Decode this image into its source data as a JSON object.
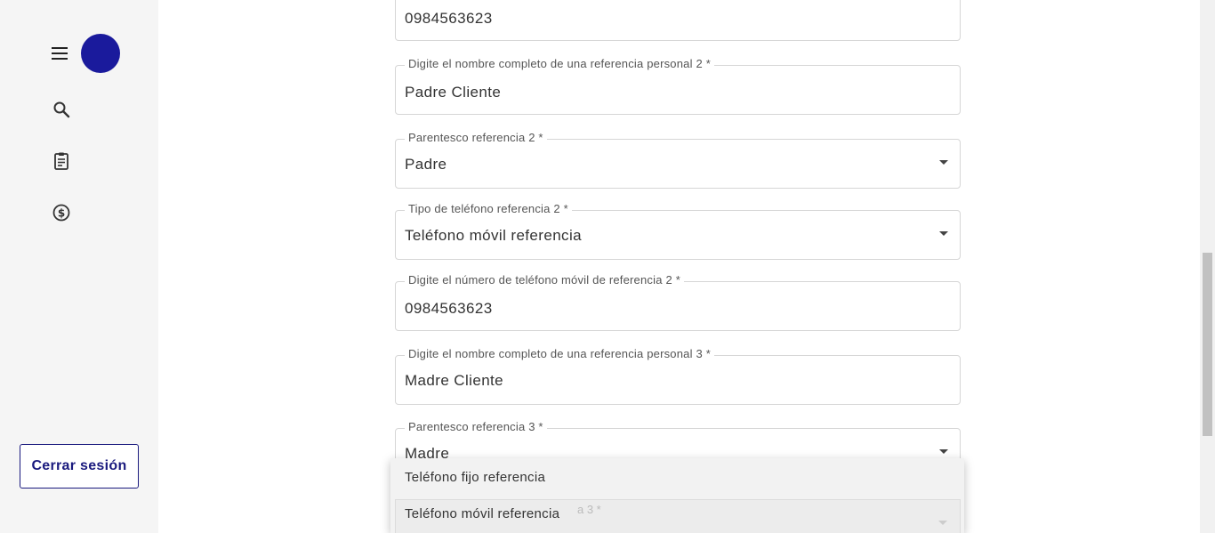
{
  "sidebar": {
    "logout_label": "Cerrar sesión",
    "icons": [
      "menu-icon",
      "search-icon",
      "clipboard-icon",
      "dollar-icon"
    ],
    "avatar_color": "#1a1a9c"
  },
  "form": {
    "fields": [
      {
        "label": "",
        "value": "0984563623",
        "type": "input"
      },
      {
        "label": "Digite el nombre completo de una referencia personal 2 *",
        "value": "Padre Cliente",
        "type": "input"
      },
      {
        "label": "Parentesco referencia 2 *",
        "value": "Padre",
        "type": "select"
      },
      {
        "label": "Tipo de teléfono referencia 2 *",
        "value": "Teléfono móvil referencia",
        "type": "select"
      },
      {
        "label": "Digite el número de teléfono móvil de referencia 2 *",
        "value": "0984563623",
        "type": "input"
      },
      {
        "label": "Digite el nombre completo de una referencia personal 3 *",
        "value": "Madre Cliente",
        "type": "input"
      },
      {
        "label": "Parentesco referencia 3 *",
        "value": "Madre",
        "type": "select"
      }
    ]
  },
  "dropdown": {
    "options": [
      "Teléfono fijo referencia",
      "Teléfono móvil referencia"
    ],
    "hidden_label_fragment": "a 3 *"
  },
  "colors": {
    "brand": "#1a1a7e",
    "sidebar_bg": "#f5f5f5"
  }
}
